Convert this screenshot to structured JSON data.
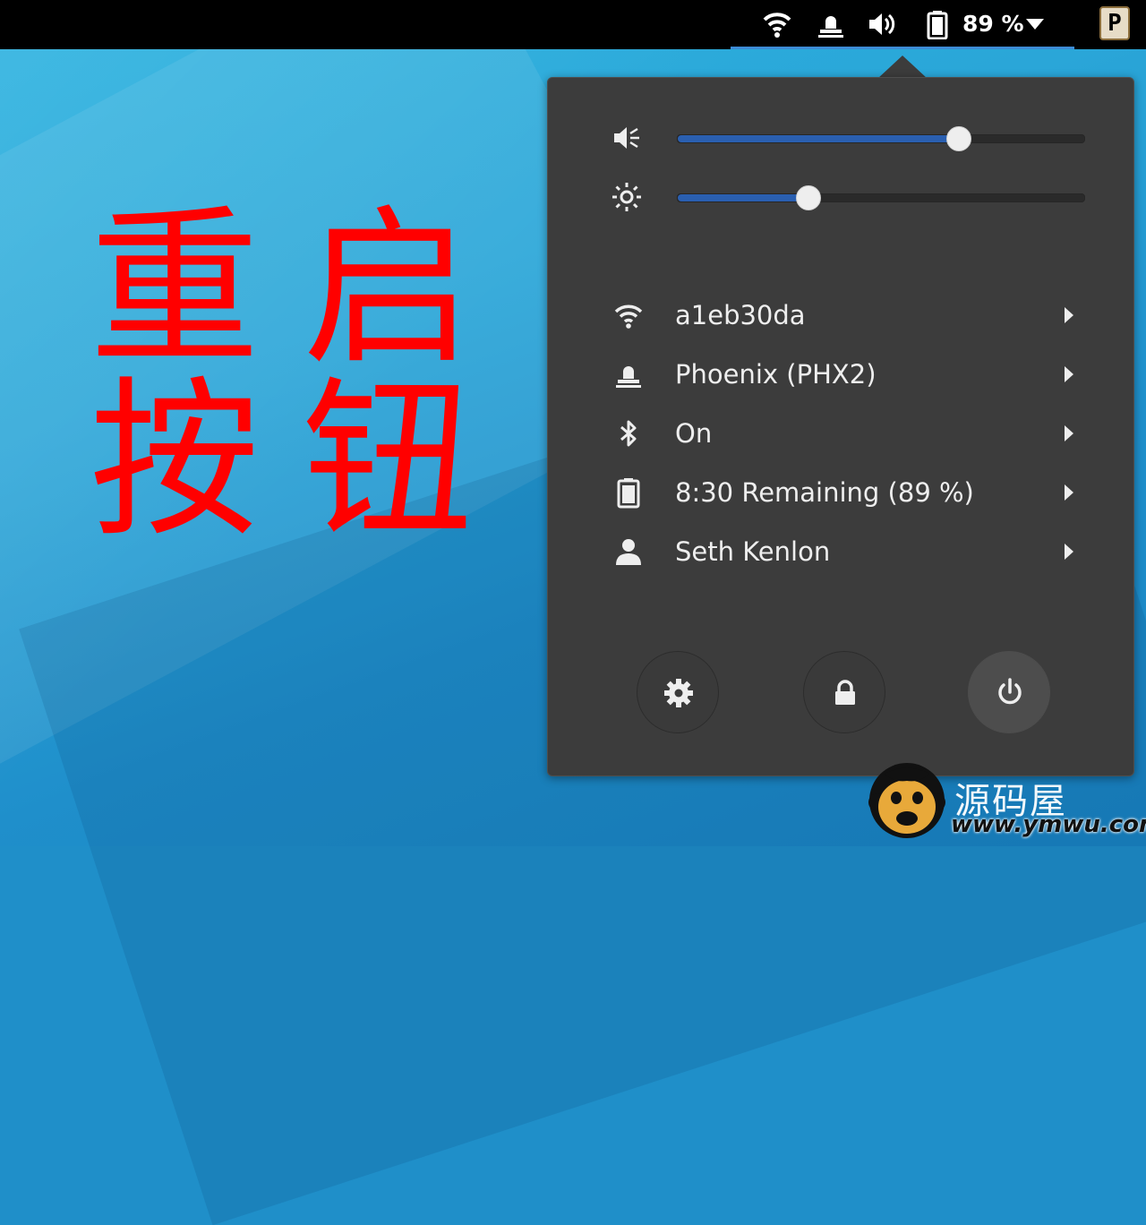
{
  "topbar": {
    "battery_text": "89 %",
    "app_icon_letter": "P",
    "status_icons": [
      "wifi-icon",
      "vpn-icon",
      "volume-icon",
      "battery-icon",
      "caret-down-icon"
    ]
  },
  "overlay": {
    "line1_char1": "重",
    "line1_char2": "启",
    "line2_char1": "按",
    "line2_char2": "钮",
    "color": "#ff0000"
  },
  "popover": {
    "volume": {
      "icon": "volume-icon",
      "level": 0.69
    },
    "brightness": {
      "icon": "brightness-icon",
      "level": 0.32
    },
    "items": [
      {
        "icon": "wifi-icon",
        "label": "a1eb30da"
      },
      {
        "icon": "vpn-icon",
        "label": "Phoenix (PHX2)"
      },
      {
        "icon": "bluetooth-icon",
        "label": "On"
      },
      {
        "icon": "battery-icon",
        "label": "8:30 Remaining (89 %)"
      },
      {
        "icon": "user-icon",
        "label": "Seth Kenlon"
      }
    ],
    "buttons": [
      "settings-icon",
      "lock-icon",
      "power-icon"
    ]
  },
  "watermark": {
    "title": "源码屋",
    "url": "www.ymwu.com"
  },
  "colors": {
    "topbar": "#000000",
    "popover": "#3c3c3c",
    "accent": "#2a5fb0",
    "text": "#eeeeee"
  }
}
